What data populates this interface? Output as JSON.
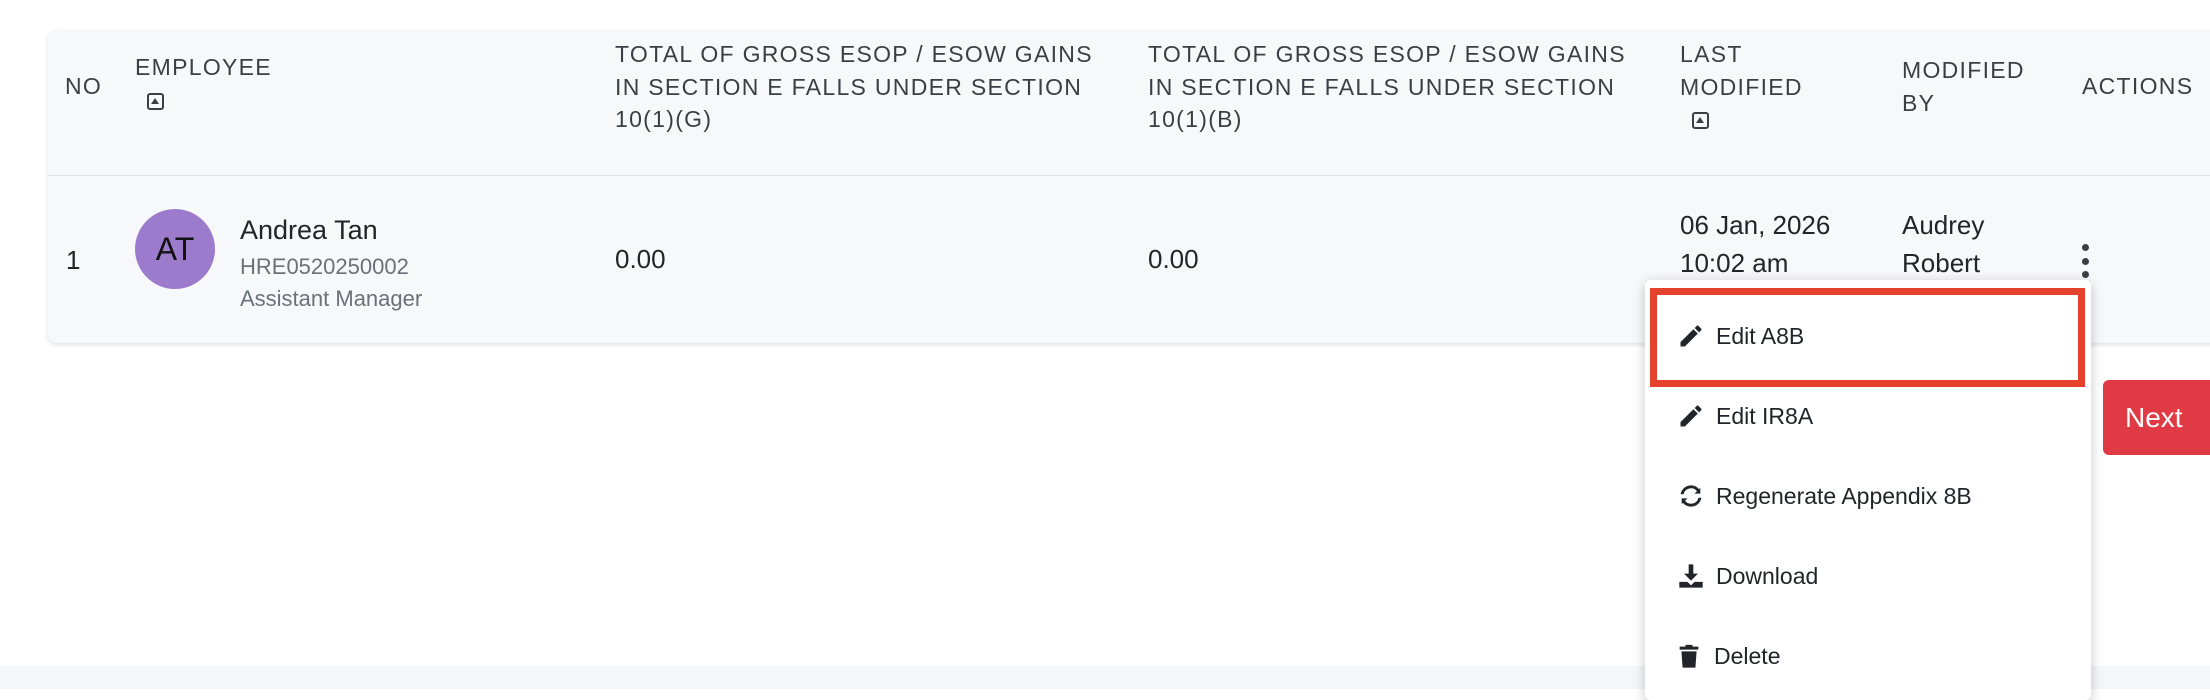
{
  "table": {
    "headers": {
      "no": "NO",
      "employee": "EMPLOYEE",
      "gross_g_line1": "TOTAL OF GROSS ESOP / ESOW GAINS",
      "gross_g_line2": "IN SECTION E FALLS UNDER SECTION",
      "gross_g_line3": "10(1)(G)",
      "gross_b_line1": "TOTAL OF GROSS ESOP / ESOW GAINS",
      "gross_b_line2": "IN SECTION E FALLS UNDER SECTION",
      "gross_b_line3": "10(1)(B)",
      "last_modified_line1": "LAST",
      "last_modified_line2": "MODIFIED",
      "modified_by_line1": "MODIFIED",
      "modified_by_line2": "BY",
      "actions": "ACTIONS"
    },
    "rows": [
      {
        "no": "1",
        "avatar_initials": "AT",
        "avatar_color": "#9c7bcc",
        "name": "Andrea Tan",
        "employee_id": "HRE0520250002",
        "position": "Assistant Manager",
        "gross_g": "0.00",
        "gross_b": "0.00",
        "last_modified_date": "06 Jan, 2026",
        "last_modified_time": "10:02 am",
        "modified_by_first": "Audrey",
        "modified_by_last": "Robert"
      }
    ]
  },
  "action_menu": {
    "items": [
      {
        "label": "Edit A8B",
        "icon": "pencil-icon"
      },
      {
        "label": "Edit IR8A",
        "icon": "pencil-icon"
      },
      {
        "label": "Regenerate Appendix 8B",
        "icon": "refresh-icon"
      },
      {
        "label": "Download",
        "icon": "download-icon"
      },
      {
        "label": "Delete",
        "icon": "trash-icon"
      }
    ],
    "highlighted_item": "Edit A8B"
  },
  "pagination": {
    "next_label": "Next"
  },
  "colors": {
    "accent_red": "#e03a44",
    "highlight_border": "#e4422c"
  }
}
